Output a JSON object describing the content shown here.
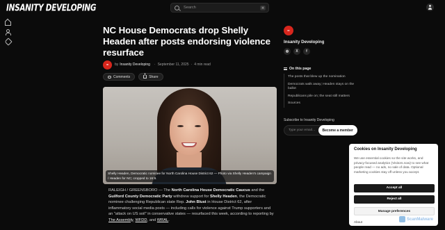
{
  "header": {
    "logo_text": "INSANITY DEVELOPING",
    "search_placeholder": "Search",
    "search_shortcut": "⌘"
  },
  "article": {
    "title": "NC House Democrats drop Shelly Headen after posts endorsing violence resurface",
    "byline_prefix": "by",
    "author": "Insanity Developing",
    "date": "September 11, 2025",
    "read_time": "4 min read",
    "comments_label": "Comments",
    "share_label": "Share",
    "image_caption": "Shelly Headen, Democratic nominee for North Carolina House District 62 — Photo via Shelly Headen's campaign / Headen for NC; cropped to 16:9.",
    "body": [
      {
        "t": "RALEIGH / GREENSBORO — The "
      },
      {
        "t": "North Carolina House Democratic Caucus",
        "b": true
      },
      {
        "t": " and the "
      },
      {
        "t": "Guilford County Democratic Party",
        "b": true
      },
      {
        "t": " withdrew support for "
      },
      {
        "t": "Shelly Headen",
        "b": true
      },
      {
        "t": ", the Democratic nominee challenging Republican state Rep. "
      },
      {
        "t": "John Blust",
        "b": true
      },
      {
        "t": " in House District 62, after inflammatory social media posts — including calls for violence against Trump supporters and an \"attack on US soil\" in conservative states — resurfaced this week, according to reporting by "
      },
      {
        "t": "The Assembly",
        "u": true
      },
      {
        "t": ", "
      },
      {
        "t": "WFDD",
        "u": true
      },
      {
        "t": ", and "
      },
      {
        "t": "WRAL",
        "u": true
      },
      {
        "t": "."
      }
    ]
  },
  "sidebar": {
    "site_name": "Insanity Developing",
    "socials": [
      "◍",
      "X",
      "f"
    ],
    "toc_heading": "On this page",
    "toc": [
      "The posts that blew up the nomination",
      "Democrats walk away; Headen stays on the ballot",
      "Republicans pile on; the seat still matters",
      "Sources"
    ],
    "subscribe_label": "Subscribe to Insanity Developing",
    "email_placeholder": "Type your email…",
    "subscribe_button": "Become a member"
  },
  "cookie": {
    "title": "Cookies on Insanity Developing",
    "text": "We use essential cookies so the site works, and privacy-focused analytics (Visitors.now) to see what people read — no ads, no sale of data. Optional marketing cookies stay off unless you accept.",
    "accept": "Accept all",
    "reject": "Reject all",
    "manage": "Manage preferences",
    "about": "About"
  },
  "watermark": "ScanMalware",
  "colors": {
    "background": "#0b0b0b",
    "brand_red": "#d8261d",
    "text": "#e6e6e6"
  }
}
